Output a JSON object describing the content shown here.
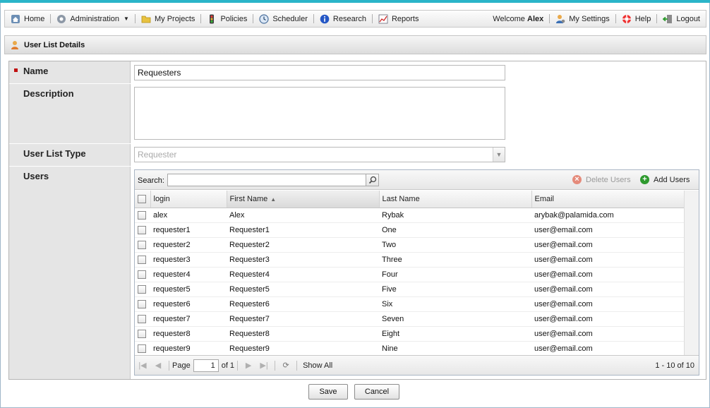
{
  "nav": {
    "home": "Home",
    "administration": "Administration",
    "my_projects": "My Projects",
    "policies": "Policies",
    "scheduler": "Scheduler",
    "research": "Research",
    "reports": "Reports",
    "welcome_prefix": "Welcome",
    "user": "Alex",
    "my_settings": "My Settings",
    "help": "Help",
    "logout": "Logout"
  },
  "panel": {
    "title": "User List Details"
  },
  "form": {
    "name_label": "Name",
    "name_value": "Requesters",
    "description_label": "Description",
    "description_value": "",
    "type_label": "User List Type",
    "type_value": "Requester",
    "users_label": "Users"
  },
  "grid": {
    "search_label": "Search:",
    "search_value": "",
    "delete_label": "Delete Users",
    "add_label": "Add Users",
    "columns": [
      "login",
      "First Name",
      "Last Name",
      "Email"
    ],
    "sorted_column": "First Name",
    "rows": [
      [
        "alex",
        "Alex",
        "Rybak",
        "arybak@palamida.com"
      ],
      [
        "requester1",
        "Requester1",
        "One",
        "user@email.com"
      ],
      [
        "requester2",
        "Requester2",
        "Two",
        "user@email.com"
      ],
      [
        "requester3",
        "Requester3",
        "Three",
        "user@email.com"
      ],
      [
        "requester4",
        "Requester4",
        "Four",
        "user@email.com"
      ],
      [
        "requester5",
        "Requester5",
        "Five",
        "user@email.com"
      ],
      [
        "requester6",
        "Requester6",
        "Six",
        "user@email.com"
      ],
      [
        "requester7",
        "Requester7",
        "Seven",
        "user@email.com"
      ],
      [
        "requester8",
        "Requester8",
        "Eight",
        "user@email.com"
      ],
      [
        "requester9",
        "Requester9",
        "Nine",
        "user@email.com"
      ]
    ],
    "pager": {
      "page_label": "Page",
      "page_value": "1",
      "of_label": "of 1",
      "show_all": "Show All",
      "range": "1 - 10 of 10"
    }
  },
  "buttons": {
    "save": "Save",
    "cancel": "Cancel"
  },
  "colors": {
    "accent": "#2bb5c9",
    "required": "#c01010",
    "add": "#2e9a2e",
    "delete": "#e58b7b"
  },
  "icons": [
    "home-icon",
    "gear-icon",
    "folder-icon",
    "traffic-light-icon",
    "clock-icon",
    "info-icon",
    "chart-icon",
    "user-settings-icon",
    "lifebuoy-icon",
    "logout-icon",
    "user-list-icon",
    "search-icon"
  ]
}
